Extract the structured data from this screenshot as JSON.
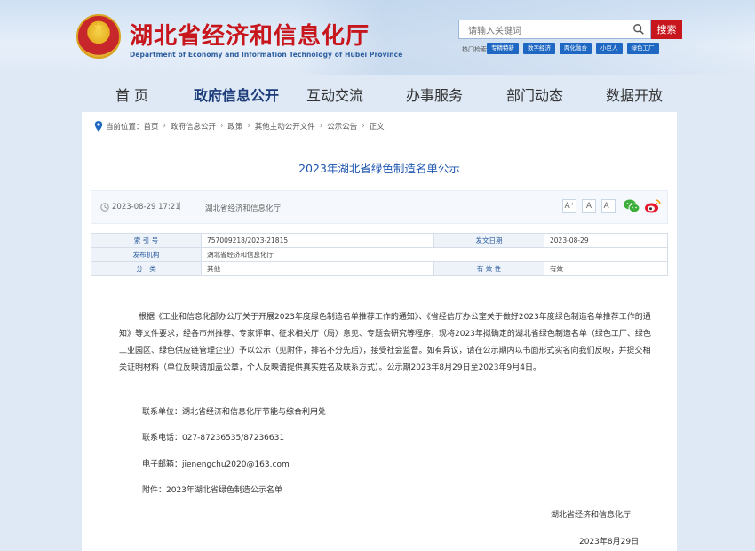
{
  "header": {
    "title": "湖北省经济和信息化厅",
    "subtitle": "Department of Economy and Information Technology of Hubei Province"
  },
  "search": {
    "placeholder": "请输入关键词",
    "button": "搜索",
    "hot_label": "热门检索",
    "hot_tags": [
      "专精特新",
      "数字经济",
      "两化融合",
      "小巨人",
      "绿色工厂"
    ]
  },
  "nav": [
    "首 页",
    "政府信息公开",
    "互动交流",
    "办事服务",
    "部门动态",
    "数据开放"
  ],
  "breadcrumb": {
    "label": "当前位置：",
    "items": [
      "首页",
      "政府信息公开",
      "政策",
      "其他主动公开文件",
      "公示公告",
      "正文"
    ]
  },
  "article": {
    "title": "2023年湖北省绿色制造名单公示",
    "date": "2023-08-29 17:21",
    "source": "湖北省经济和信息化厅",
    "font_sizes": [
      "A⁺",
      "A",
      "A⁻"
    ],
    "info": {
      "index_label": "索 引 号",
      "index_value": "757009218/2023-21815",
      "date_label": "发文日期",
      "date_value": "2023-08-29",
      "issuer_label": "发布机构",
      "issuer_value": "湖北省经济和信息化厅",
      "category_label": "分　类",
      "category_value": "其他",
      "validity_label": "有 效 性",
      "validity_value": "有效"
    },
    "body": "根据《工业和信息化部办公厅关于开展2023年度绿色制造名单推荐工作的通知》、《省经信厅办公室关于做好2023年度绿色制造名单推荐工作的通知》等文件要求，经各市州推荐、专家评审、征求相关厅（局）意见、专题会研究等程序，现将2023年拟确定的湖北省绿色制造名单（绿色工厂、绿色工业园区、绿色供应链管理企业）予以公示（见附件，排名不分先后），接受社会监督。如有异议，请在公示期内以书面形式实名向我们反映，并提交相关证明材料（单位反映请加盖公章，个人反映请提供真实姓名及联系方式）。公示期2023年8月29日至2023年9月4日。",
    "contact_unit": "联系单位：湖北省经济和信息化厅节能与综合利用处",
    "contact_phone": "联系电话：027-87236535/87236631",
    "contact_email": "电子邮箱：jienengchu2020@163.com",
    "attachment": "附件：2023年湖北省绿色制造公示名单",
    "sign_org": "湖北省经济和信息化厅",
    "sign_date": "2023年8月29日"
  }
}
